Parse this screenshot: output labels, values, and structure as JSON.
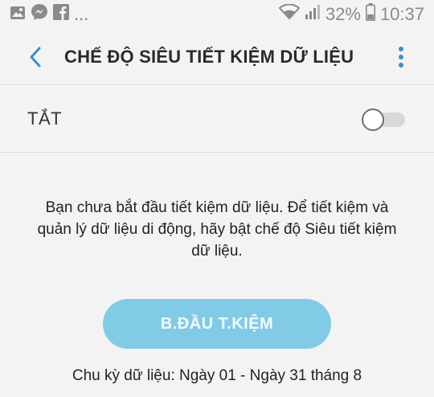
{
  "status_bar": {
    "overflow": "...",
    "battery": "32%",
    "time": "10:37",
    "icons": [
      "gallery-icon",
      "messenger-icon",
      "facebook-icon",
      "wifi-icon",
      "signal-icon",
      "battery-icon"
    ]
  },
  "app_bar": {
    "title": "CHẾ ĐỘ SIÊU TIẾT KIỆM DỮ LIỆU",
    "accent": "#3b8fc9"
  },
  "switch": {
    "label": "TẮT",
    "state": "off"
  },
  "description": "Bạn chưa bắt đầu tiết kiệm dữ liệu. Để tiết kiệm và quản lý dữ liệu di động, hãy bật chế độ Siêu tiết kiệm dữ liệu.",
  "start_button": {
    "label": "B.ĐẦU T.KIỆM",
    "color": "#82cbe6"
  },
  "cycle_text": "Chu kỳ dữ liệu: Ngày 01 - Ngày 31 tháng 8"
}
